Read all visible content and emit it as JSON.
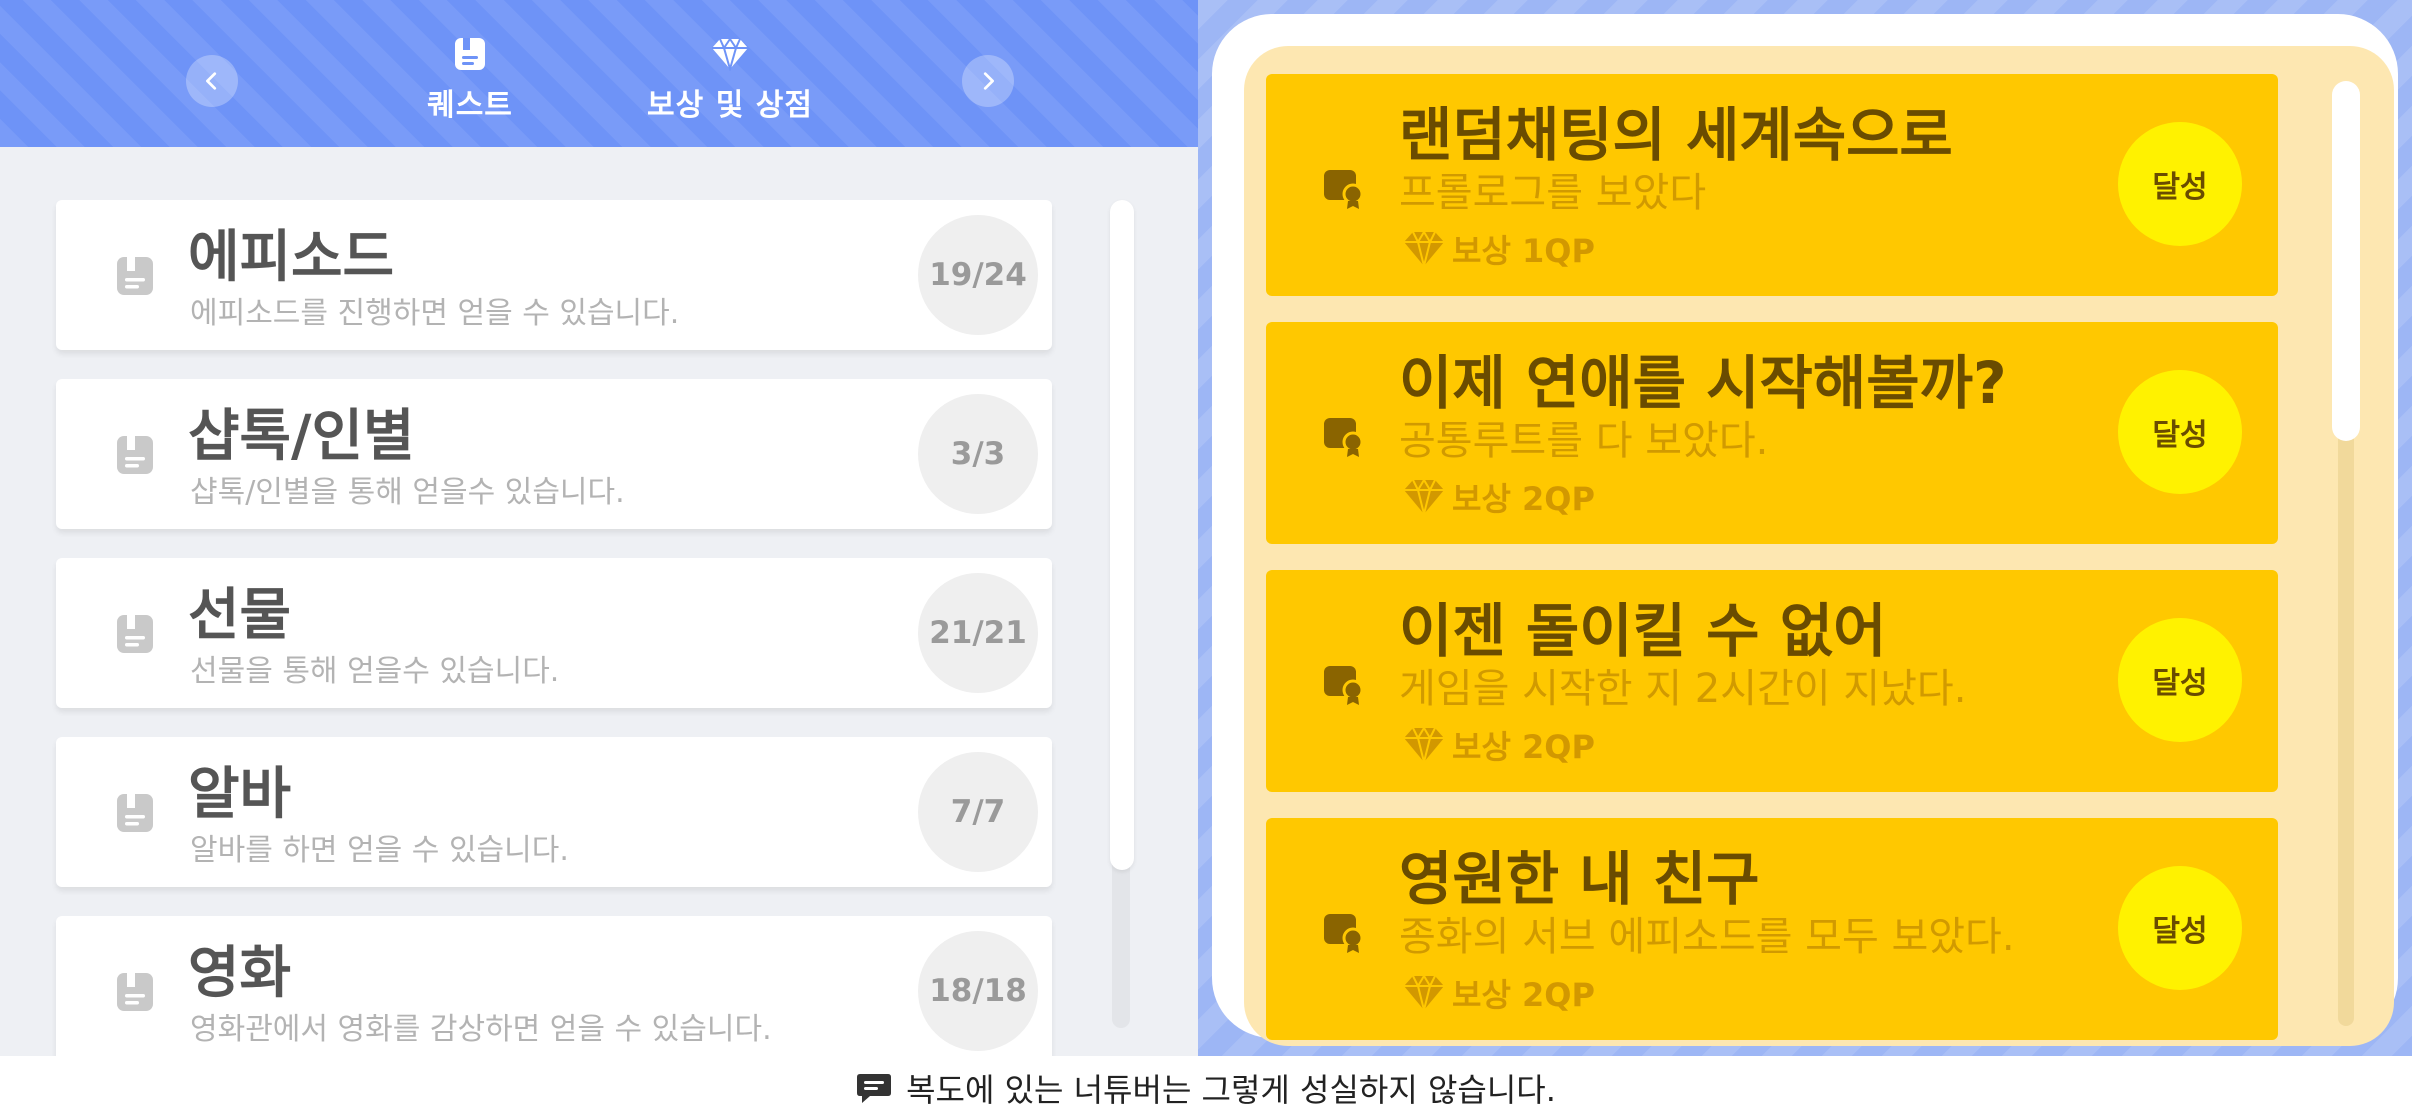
{
  "header": {
    "tabs": [
      {
        "label": "퀘스트",
        "icon": "quest-book-icon"
      },
      {
        "label": "보상 및 상점",
        "icon": "diamond-icon"
      }
    ],
    "prev_icon": "chevron-left-icon",
    "next_icon": "chevron-right-icon"
  },
  "quests": [
    {
      "title": "에피소드",
      "desc": "에피소드를 진행하면 얻을 수 있습니다.",
      "progress": "19/24"
    },
    {
      "title": "샵톡/인별",
      "desc": "샵톡/인별을 통해 얻을수 있습니다.",
      "progress": "3/3"
    },
    {
      "title": "선물",
      "desc": "선물을 통해 얻을수 있습니다.",
      "progress": "21/21"
    },
    {
      "title": "알바",
      "desc": "알바를 하면 얻을 수 있습니다.",
      "progress": "7/7"
    },
    {
      "title": "영화",
      "desc": "영화관에서 영화를 감상하면 얻을 수 있습니다.",
      "progress": "18/18"
    }
  ],
  "achievements": [
    {
      "title": "랜덤채팅의 세계속으로",
      "desc": "프롤로그를 보았다",
      "reward": "보상 1QP",
      "status": "달성"
    },
    {
      "title": "이제 연애를 시작해볼까?",
      "desc": "공통루트를 다 보았다.",
      "reward": "보상 2QP",
      "status": "달성"
    },
    {
      "title": "이젠 돌이킬 수 없어",
      "desc": "게임을 시작한 지 2시간이 지났다.",
      "reward": "보상 2QP",
      "status": "달성"
    },
    {
      "title": "영원한 내 친구",
      "desc": "종화의 서브 에피소드를 모두 보았다.",
      "reward": "보상 2QP",
      "status": "달성"
    }
  ],
  "dialogue": {
    "text": "복도에 있는 너튜버는 그렇게 성실하지 않습니다.",
    "icon": "chat-icon"
  },
  "colors": {
    "header_blue": "#6e93f7",
    "achievement_yellow": "#ffc800",
    "badge_yellow": "#fff200",
    "title_brown": "#6a4c00"
  }
}
